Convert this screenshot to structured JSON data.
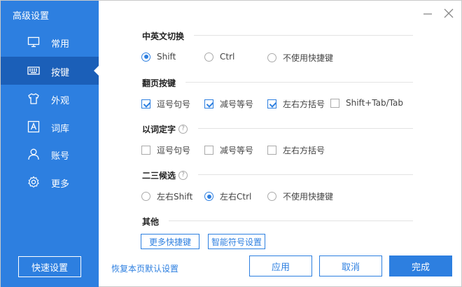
{
  "sidebar": {
    "title": "高级设置",
    "items": [
      {
        "label": "常用",
        "icon": "monitor-icon"
      },
      {
        "label": "按键",
        "icon": "keyboard-icon"
      },
      {
        "label": "外观",
        "icon": "tshirt-icon"
      },
      {
        "label": "词库",
        "icon": "dictionary-icon"
      },
      {
        "label": "账号",
        "icon": "user-icon"
      },
      {
        "label": "更多",
        "icon": "gear-icon"
      }
    ],
    "active_index": 1,
    "quick_button": "快速设置"
  },
  "sections": {
    "switch": {
      "title": "中英文切换",
      "options": [
        "Shift",
        "Ctrl",
        "不使用快捷键"
      ],
      "selected": 0
    },
    "paging": {
      "title": "翻页按键",
      "options": [
        "逗号句号",
        "减号等号",
        "左右方括号",
        "Shift+Tab/Tab"
      ],
      "checked": [
        true,
        true,
        true,
        false
      ]
    },
    "word_select": {
      "title": "以词定字",
      "help": "?",
      "options": [
        "逗号句号",
        "减号等号",
        "左右方括号"
      ],
      "checked": [
        false,
        false,
        false
      ]
    },
    "candidate": {
      "title": "二三候选",
      "help": "?",
      "options": [
        "左右Shift",
        "左右Ctrl",
        "不使用快捷键"
      ],
      "selected": 1
    },
    "other": {
      "title": "其他",
      "buttons": [
        "更多快捷键",
        "智能符号设置"
      ]
    }
  },
  "footer": {
    "reset": "恢复本页默认设置",
    "apply": "应用",
    "cancel": "取消",
    "done": "完成"
  },
  "colors": {
    "accent": "#2d7fe0",
    "sidebar_active": "#1b5fb8"
  }
}
